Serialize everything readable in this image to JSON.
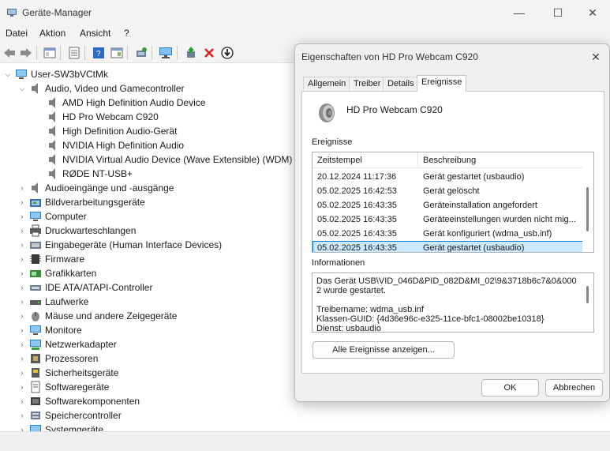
{
  "window": {
    "title": "Geräte-Manager",
    "minimize": "—",
    "maximize": "☐",
    "close": "✕"
  },
  "menu": [
    "Datei",
    "Aktion",
    "Ansicht",
    "?"
  ],
  "tree": {
    "root": "User-SW3bVCtMk",
    "expanded_category": "Audio, Video und Gamecontroller",
    "devices": [
      "AMD High Definition Audio Device",
      "HD Pro Webcam C920",
      "High Definition Audio-Gerät",
      "NVIDIA High Definition Audio",
      "NVIDIA Virtual Audio Device (Wave Extensible) (WDM)",
      "RØDE NT-USB+"
    ],
    "categories": [
      {
        "label": "Audioeingänge und -ausgänge",
        "icon": "speaker-icon"
      },
      {
        "label": "Bildverarbeitungsgeräte",
        "icon": "camera-icon"
      },
      {
        "label": "Computer",
        "icon": "monitor-icon"
      },
      {
        "label": "Druckwarteschlangen",
        "icon": "printer-icon"
      },
      {
        "label": "Eingabegeräte (Human Interface Devices)",
        "icon": "hid-icon"
      },
      {
        "label": "Firmware",
        "icon": "chip-icon"
      },
      {
        "label": "Grafikkarten",
        "icon": "display-adapter-icon"
      },
      {
        "label": "IDE ATA/ATAPI-Controller",
        "icon": "ide-controller-icon"
      },
      {
        "label": "Laufwerke",
        "icon": "drive-icon"
      },
      {
        "label": "Mäuse und andere Zeigegeräte",
        "icon": "mouse-icon"
      },
      {
        "label": "Monitore",
        "icon": "monitor-icon"
      },
      {
        "label": "Netzwerkadapter",
        "icon": "network-adapter-icon"
      },
      {
        "label": "Prozessoren",
        "icon": "processor-icon"
      },
      {
        "label": "Sicherheitsgeräte",
        "icon": "security-device-icon"
      },
      {
        "label": "Softwaregeräte",
        "icon": "software-device-icon"
      },
      {
        "label": "Softwarekomponenten",
        "icon": "software-component-icon"
      },
      {
        "label": "Speichercontroller",
        "icon": "storage-controller-icon"
      },
      {
        "label": "Systemgeräte",
        "icon": "system-device-icon"
      }
    ]
  },
  "dialog": {
    "title": "Eigenschaften von HD Pro Webcam C920",
    "close": "✕",
    "tabs": [
      "Allgemein",
      "Treiber",
      "Details",
      "Ereignisse"
    ],
    "active_tab": "Ereignisse",
    "device_name": "HD Pro Webcam C920",
    "events_label": "Ereignisse",
    "columns": [
      "Zeitstempel",
      "Beschreibung"
    ],
    "events": [
      {
        "time": "20.12.2024 11:17:36",
        "desc": "Gerät gestartet (usbaudio)"
      },
      {
        "time": "05.02.2025 16:42:53",
        "desc": "Gerät gelöscht"
      },
      {
        "time": "05.02.2025 16:43:35",
        "desc": "Geräteinstallation angefordert"
      },
      {
        "time": "05.02.2025 16:43:35",
        "desc": "Geräteeinstellungen wurden nicht mig..."
      },
      {
        "time": "05.02.2025 16:43:35",
        "desc": "Gerät konfiguriert (wdma_usb.inf)"
      },
      {
        "time": "05.02.2025 16:43:35",
        "desc": "Gerät gestartet (usbaudio)"
      }
    ],
    "selected_event_index": 5,
    "info_label": "Informationen",
    "info_text": "Das Gerät USB\\VID_046D&PID_082D&MI_02\\9&3718b6c7&0&0002 wurde gestartet.\n\nTreibername: wdma_usb.inf\nKlassen-GUID: {4d36e96c-e325-11ce-bfc1-08002be10318}\nDienst: usbaudio",
    "all_events_button": "Alle Ereignisse anzeigen...",
    "ok_button": "OK",
    "cancel_button": "Abbrechen"
  }
}
